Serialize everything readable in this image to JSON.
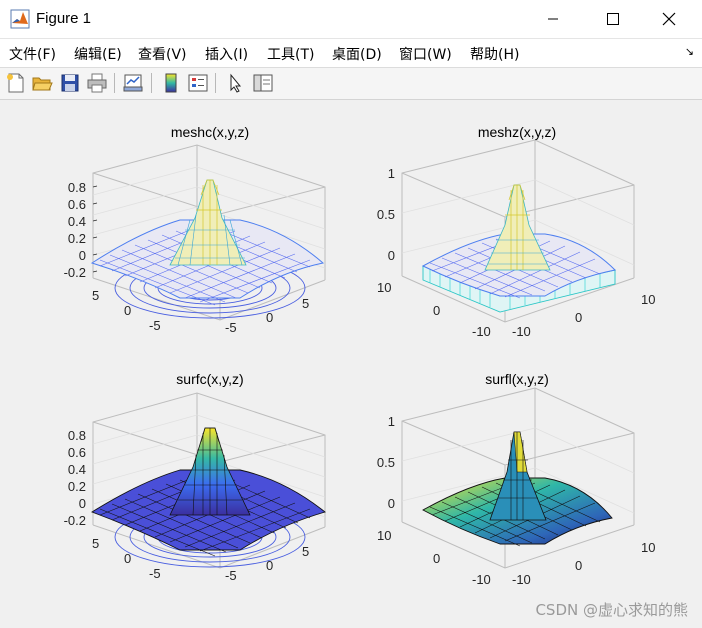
{
  "window": {
    "title": "Figure 1",
    "icon": "matlab-logo-icon",
    "controls": [
      "minimize",
      "maximize",
      "close"
    ]
  },
  "menubar": {
    "items": [
      "文件(F)",
      "编辑(E)",
      "查看(V)",
      "插入(I)",
      "工具(T)",
      "桌面(D)",
      "窗口(W)",
      "帮助(H)"
    ],
    "overflow_arrow": "↘"
  },
  "toolbar": {
    "buttons": [
      "new-figure-icon",
      "open-folder-icon",
      "save-disk-icon",
      "print-icon",
      "link-plot-icon",
      "colorbar-icon",
      "legend-icon",
      "pointer-cursor-icon",
      "property-editor-icon"
    ]
  },
  "subplots": [
    {
      "title": "meshc(x,y,z)",
      "z_ticks": [
        "0.8",
        "0.6",
        "0.4",
        "0.2",
        "0",
        "-0.2"
      ],
      "y_ticks": [
        "5",
        "0",
        "-5"
      ],
      "x_ticks": [
        "-5",
        "0",
        "5"
      ]
    },
    {
      "title": "meshz(x,y,z)",
      "z_ticks": [
        "1",
        "0.5",
        "0"
      ],
      "y_ticks": [
        "10",
        "0",
        "-10"
      ],
      "x_ticks": [
        "-10",
        "0",
        "10"
      ]
    },
    {
      "title": "surfc(x,y,z)",
      "z_ticks": [
        "0.8",
        "0.6",
        "0.4",
        "0.2",
        "0",
        "-0.2"
      ],
      "y_ticks": [
        "5",
        "0",
        "-5"
      ],
      "x_ticks": [
        "-5",
        "0",
        "5"
      ]
    },
    {
      "title": "surfl(x,y,z)",
      "z_ticks": [
        "1",
        "0.5",
        "0"
      ],
      "y_ticks": [
        "10",
        "0",
        "-10"
      ],
      "x_ticks": [
        "-10",
        "0",
        "10"
      ]
    }
  ],
  "watermark": "CSDN @虚心求知的熊",
  "colors": {
    "peak_yellow": "#f9e52a",
    "mesh_blue": "#3a6cf0",
    "mesh_purple": "#5a32c8",
    "cyan_skirt": "#3ad6d6",
    "surf_dark": "#1c1a6e"
  }
}
